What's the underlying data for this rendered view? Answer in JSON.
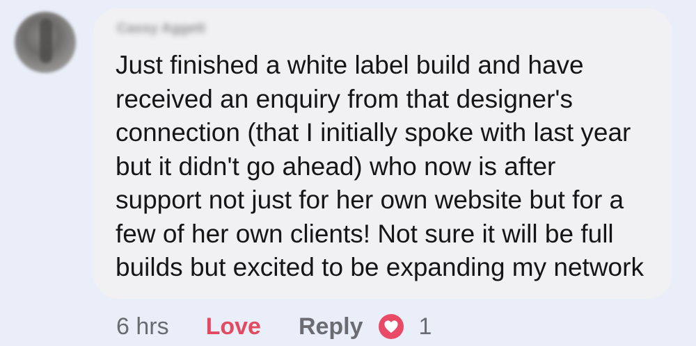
{
  "comment": {
    "author": "Cassy Aggett",
    "text_lines": [
      "Just finished a white label build and have",
      "received an enquiry from that designer's",
      "connection (that I initially spoke with last year",
      "but it didn't go ahead) who now is after",
      "support not just for her own website but for a",
      "few of her own clients! Not sure it will be full",
      "builds but excited to be expanding my network"
    ]
  },
  "actions": {
    "timestamp": "6 hrs",
    "love_label": "Love",
    "reply_label": "Reply",
    "reaction_icon": "heart-icon",
    "reaction_count": "1"
  },
  "colors": {
    "page_background": "#e9eef8",
    "bubble_background": "#f1f1f3",
    "text": "#151515",
    "love": "#e14a60",
    "reaction_heart": "#e94b67",
    "muted": "#696b70"
  }
}
